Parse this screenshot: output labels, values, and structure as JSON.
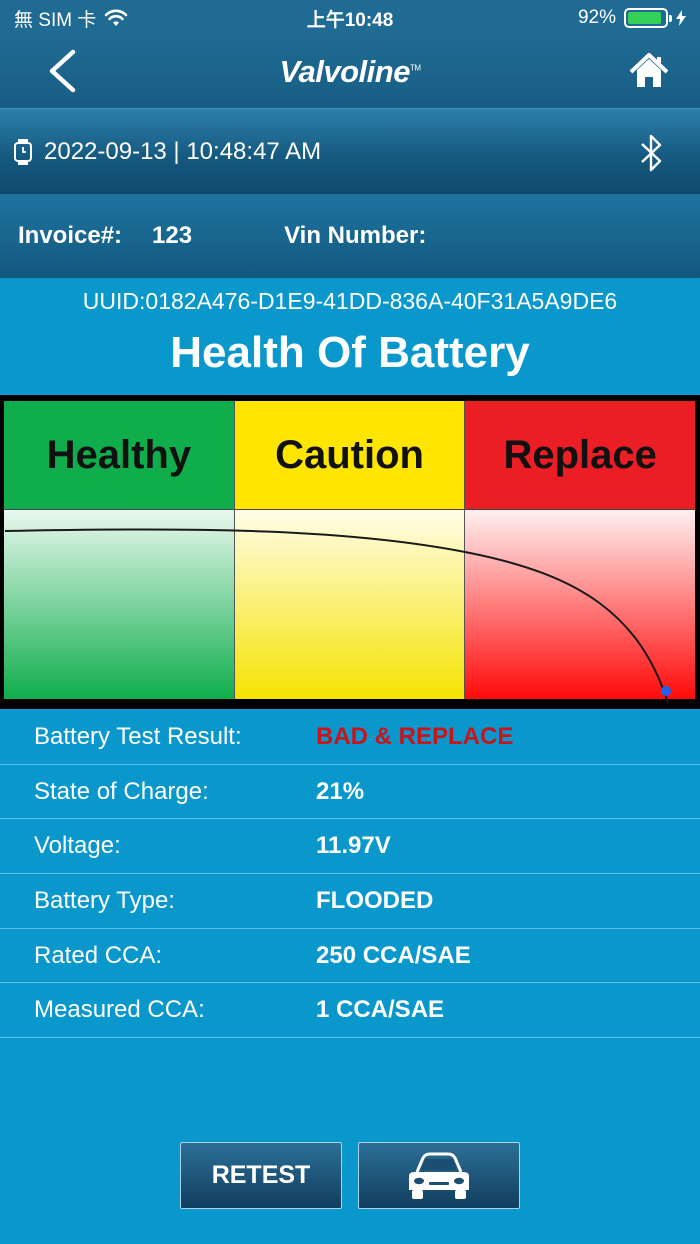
{
  "status_bar": {
    "carrier": "無 SIM 卡",
    "time": "上午10:48",
    "battery_percent": "92%",
    "battery_level": 0.92
  },
  "nav": {
    "brand": "Valvoline",
    "brand_tm": "TM"
  },
  "datetime": "2022-09-13 | 10:48:47 AM",
  "invoice": {
    "invoice_label": "Invoice#:",
    "invoice_value": "123",
    "vin_label": "Vin Number:",
    "vin_value": ""
  },
  "uuid": "UUID:0182A476-D1E9-41DD-836A-40F31A5A9DE6",
  "title": "Health Of Battery",
  "gauge": {
    "zones": [
      "Healthy",
      "Caution",
      "Replace"
    ],
    "zone_colors": [
      "#10ad4d",
      "#ffe600",
      "#eb1d25"
    ],
    "curve_color": "#1a1a1a",
    "marker_color": "#1e63e9"
  },
  "results": [
    {
      "label": "Battery Test Result:",
      "value": "BAD & REPLACE",
      "status": "bad"
    },
    {
      "label": "State of Charge:",
      "value": "21%"
    },
    {
      "label": "Voltage:",
      "value": "11.97V"
    },
    {
      "label": "Battery Type:",
      "value": "FLOODED"
    },
    {
      "label": "Rated CCA:",
      "value": "250 CCA/SAE"
    },
    {
      "label": "Measured CCA:",
      "value": "1 CCA/SAE"
    }
  ],
  "buttons": {
    "retest": "RETEST",
    "vehicle_icon": "car-icon"
  }
}
